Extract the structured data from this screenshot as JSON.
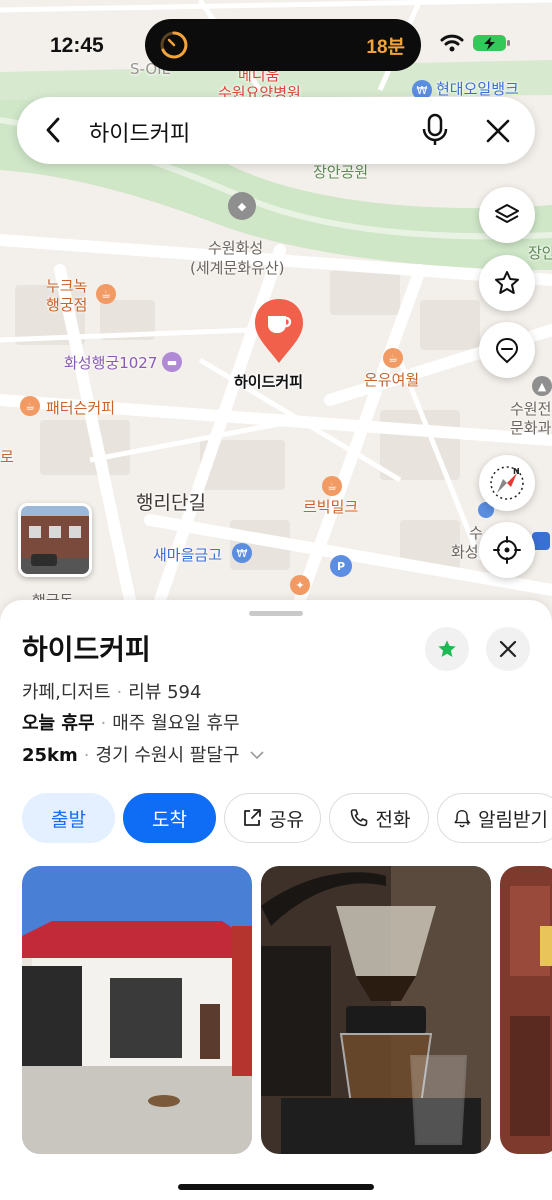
{
  "status_bar": {
    "time": "12:45",
    "timer": "18분"
  },
  "search": {
    "query": "하이드커피"
  },
  "map": {
    "labels": {
      "s_oil": "S-OIL",
      "medigum": "메디움",
      "hospital": "수원요양병원",
      "oilbank": "현대오일뱅크",
      "jangan_park": "장안공원",
      "jangan": "장안",
      "hwaseong_1": "수원화성",
      "hwaseong_2": "(세계문화유산)",
      "nukeunok_1": "누크녹",
      "nukeunok_2": "행궁점",
      "hwaseong_1027": "화성행궁1027",
      "ondu": "온유여월",
      "suwon_culture_1": "수원전",
      "suwon_culture_2": "문화과",
      "pattersons": "패터슨커피",
      "ro": "로",
      "haengridan": "행리단길",
      "rebigmilk": "르빅밀크",
      "saemaeul": "새마을금고",
      "su_hwa_1": "수",
      "su_hwa_2": "화성",
      "haenggung": "행궁동"
    },
    "pin_label": "하이드커피"
  },
  "colors": {
    "accent": "#0f6cf5",
    "pin": "#f0604a",
    "favorite": "#1db954",
    "timer": "#f2a33a"
  },
  "place": {
    "name": "하이드커피",
    "category": "카페,디저트",
    "review": "리뷰 594",
    "today_status": "오늘 휴무",
    "holiday": "매주 월요일 휴무",
    "distance": "25km",
    "address": "경기 수원시 팔달구"
  },
  "actions": {
    "depart": "출발",
    "arrive": "도착",
    "share": "공유",
    "call": "전화",
    "notify": "알림받기"
  },
  "icons": [
    "chevron-left-icon",
    "mic-icon",
    "close-icon",
    "layers-icon",
    "star-icon",
    "location-pin-icon",
    "compass-icon",
    "crosshair-icon",
    "share-icon",
    "phone-icon",
    "bell-icon",
    "wifi-icon",
    "battery-icon"
  ]
}
